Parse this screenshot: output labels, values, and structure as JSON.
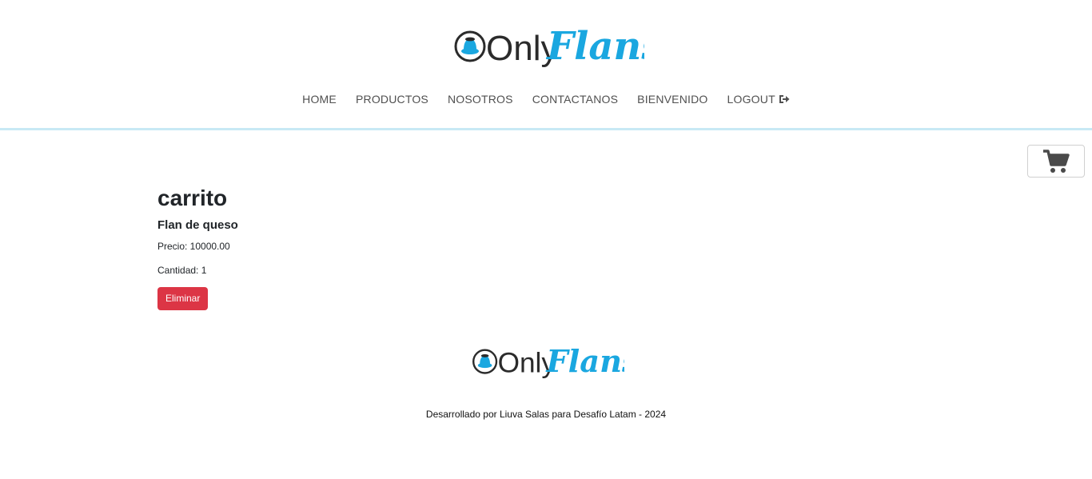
{
  "brand": {
    "name_part1": "Only",
    "name_part2": "Flans",
    "accent_color": "#1aa7e0"
  },
  "nav": {
    "items": [
      {
        "label": "HOME"
      },
      {
        "label": "PRODUCTOS"
      },
      {
        "label": "NOSOTROS"
      },
      {
        "label": "CONTACTANOS"
      },
      {
        "label": "BIENVENIDO"
      },
      {
        "label": "LOGOUT",
        "icon": "logout-icon"
      }
    ]
  },
  "cart_button": {
    "icon": "shopping-cart-icon"
  },
  "cart": {
    "title": "carrito",
    "items": [
      {
        "name": "Flan de queso",
        "price_text": "Precio: 10000.00",
        "quantity_text": "Cantidad: 1",
        "delete_label": "Eliminar"
      }
    ]
  },
  "footer": {
    "credit": "Desarrollado por Liuva Salas para Desafío Latam - 2024"
  },
  "colors": {
    "danger": "#dc3545",
    "header_border": "#c8e9f5",
    "nav_text": "#505050"
  }
}
